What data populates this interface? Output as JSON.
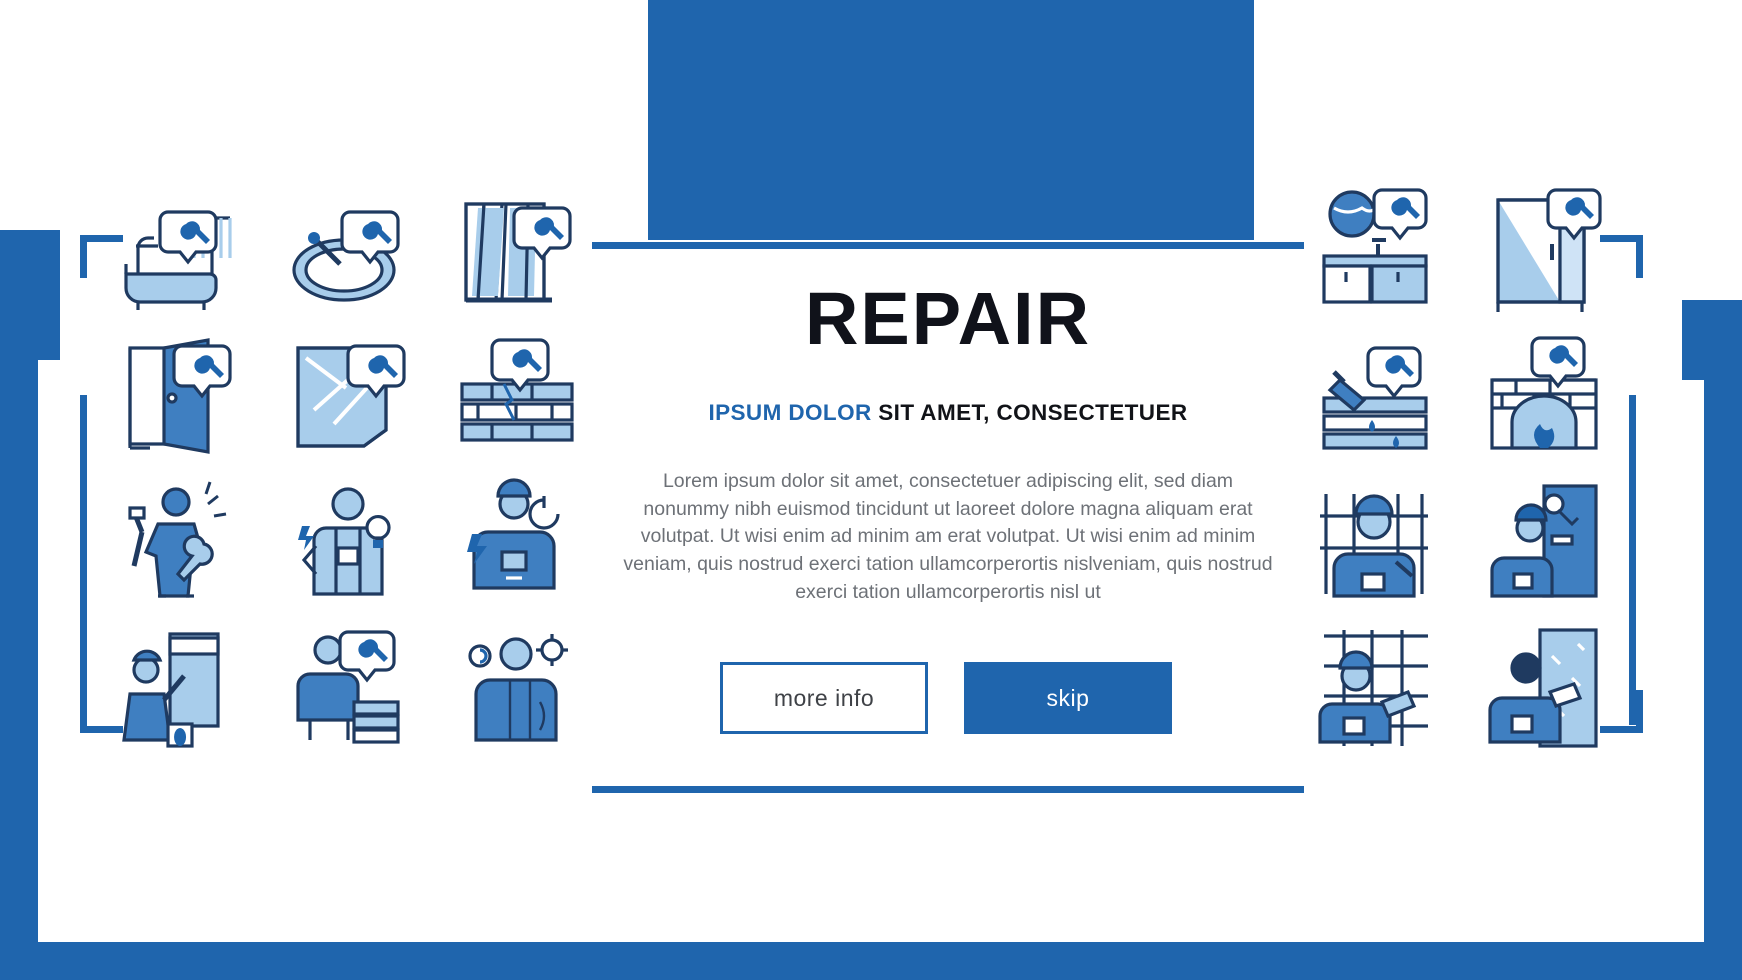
{
  "page": {
    "title": "REPAIR",
    "subtitle_accent": "IPSUM DOLOR",
    "subtitle_rest": " SIT AMET, CONSECTETUER",
    "body": "Lorem ipsum dolor sit amet, consectetuer adipiscing elit, sed diam nonummy nibh euismod tincidunt ut laoreet dolore magna aliquam erat volutpat. Ut wisi enim ad minim am erat volutpat. Ut wisi enim ad minim veniam, quis nostrud exerci tation ullamcorperortis nislveniam, quis nostrud exerci tation ullamcorperortis nisl ut",
    "buttons": {
      "more_info": "more info",
      "skip": "skip"
    },
    "colors": {
      "brand_blue": "#1f65ad",
      "light_blue": "#a8cdeb",
      "mid_blue": "#3f7fc1",
      "text_dark": "#10121a",
      "text_body": "#6d7177"
    }
  },
  "icons": {
    "left": [
      "bathtub-shower-repair-icon",
      "sink-basin-repair-icon",
      "window-glass-repair-icon",
      "door-repair-icon",
      "broken-window-repair-icon",
      "brick-wall-crack-repair-icon",
      "handyman-with-tools-icon",
      "electrician-lightbulb-icon",
      "electrician-worker-icon",
      "painter-roller-icon",
      "worker-tiles-repair-icon",
      "carpenter-wood-repair-icon"
    ],
    "right": [
      "kitchen-counter-repair-icon",
      "wardrobe-cabinet-repair-icon",
      "pipe-leak-repair-icon",
      "fireplace-repair-icon",
      "fence-repair-worker-icon",
      "lock-door-repair-icon",
      "tile-grid-worker-icon",
      "wall-plaster-worker-icon"
    ]
  }
}
